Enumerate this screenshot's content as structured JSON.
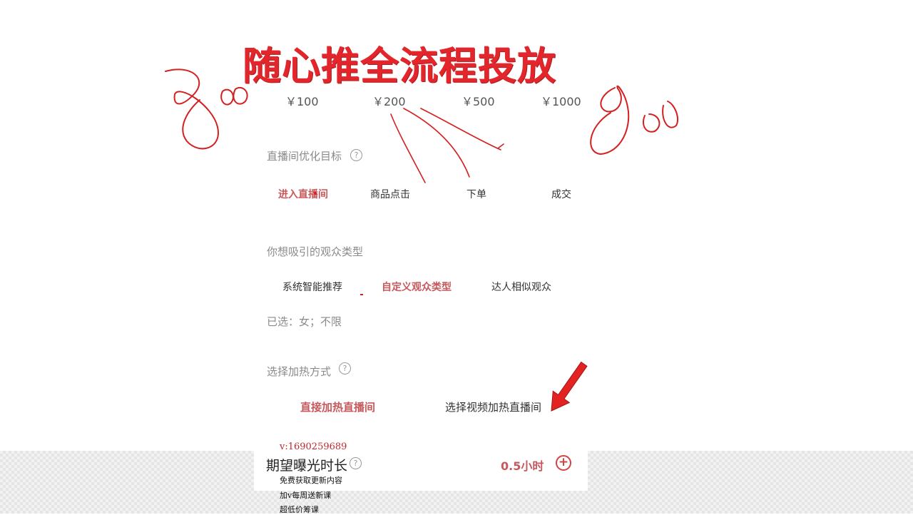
{
  "title": "随心推全流程投放",
  "prices": [
    "￥100",
    "￥200",
    "￥500",
    "￥1000"
  ],
  "goal": {
    "label": "直播间优化目标",
    "help": "?",
    "options": [
      "进入直播间",
      "商品点击",
      "下单",
      "成交"
    ],
    "selected_index": 0
  },
  "audience": {
    "label": "你想吸引的观众类型",
    "options": [
      "系统智能推荐",
      "自定义观众类型",
      "达人相似观众"
    ],
    "selected_index": 1,
    "selected_text": "已选：女；不限"
  },
  "heating": {
    "label": "选择加热方式",
    "help": "?",
    "options": [
      "直接加热直播间",
      "选择视频加热直播间"
    ],
    "selected_index": 0
  },
  "exposure": {
    "label": "期望曝光时长",
    "help": "?",
    "value": "0.5小时",
    "add_icon": "plus-circle-icon"
  },
  "contact": {
    "v": "v:1690259689",
    "line1": "免费获取更新内容",
    "line2": "加v每周送新课",
    "line3": "超低价筹课"
  },
  "handwriting": {
    "left": "800",
    "right": "800"
  },
  "colors": {
    "title": "#e3262b",
    "accent": "#c8585b",
    "arrow": "#e32222",
    "ink": "#d42020"
  }
}
